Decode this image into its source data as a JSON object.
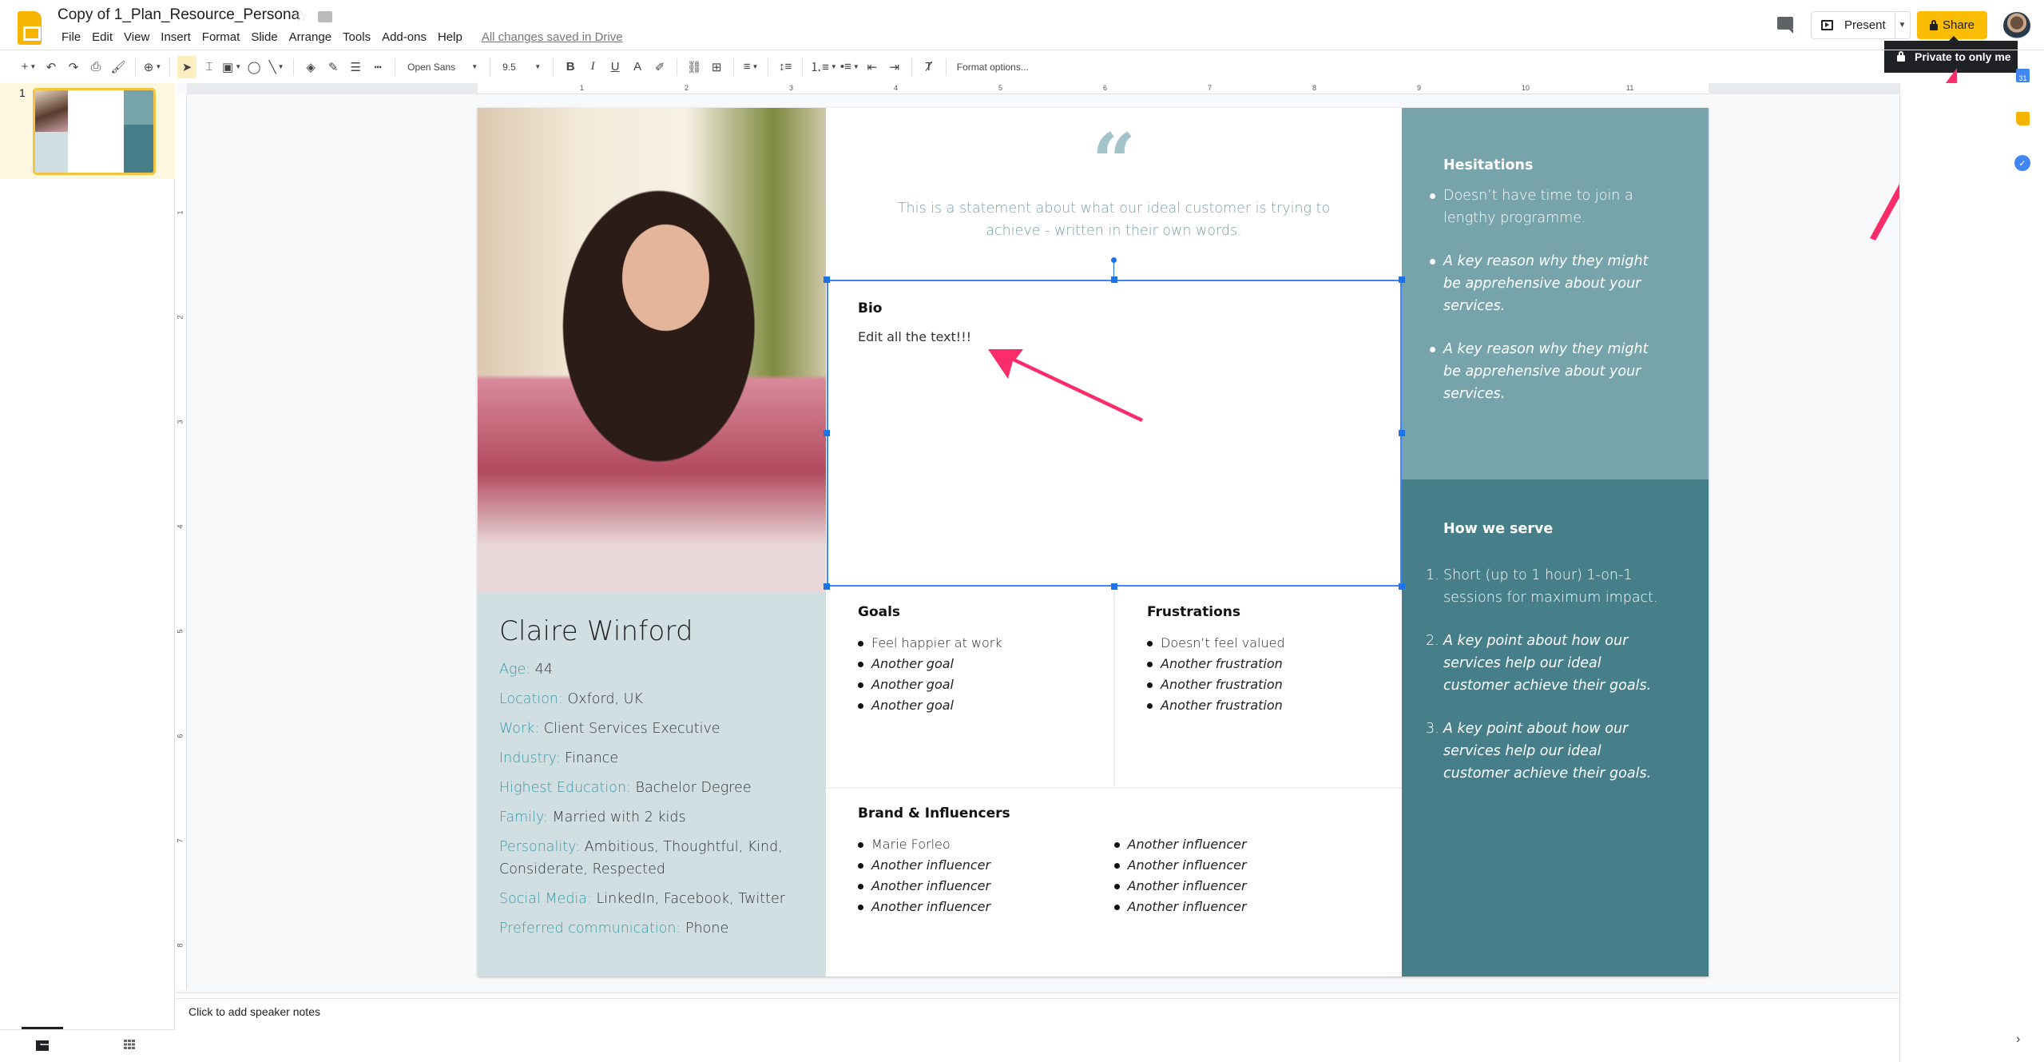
{
  "app": {
    "doc_title": "Copy of 1_Plan_Resource_Persona",
    "save_status": "All changes saved in Drive",
    "menu": [
      "File",
      "Edit",
      "View",
      "Insert",
      "Format",
      "Slide",
      "Arrange",
      "Tools",
      "Add-ons",
      "Help"
    ]
  },
  "header": {
    "present_label": "Present",
    "share_label": "Share",
    "tooltip": "Private to only me"
  },
  "toolbar": {
    "font": "Open Sans",
    "font_size": "9.5",
    "bold": "B",
    "italic": "I",
    "underline": "U",
    "text_color": "A",
    "format_options": "Format options..."
  },
  "ruler": {
    "h_marks": [
      "1",
      "2",
      "3",
      "4",
      "5",
      "6",
      "7",
      "8",
      "9",
      "10",
      "11"
    ],
    "v_marks": [
      "1",
      "2",
      "3",
      "4",
      "5",
      "6",
      "7",
      "8"
    ]
  },
  "filmstrip": {
    "slide_number": "1"
  },
  "slide": {
    "persona": {
      "name": "Claire Winford",
      "attributes": [
        {
          "k": "Age:",
          "v": " 44"
        },
        {
          "k": "Location:",
          "v": " Oxford, UK"
        },
        {
          "k": "Work:",
          "v": " Client Services Executive"
        },
        {
          "k": "Industry:",
          "v": " Finance"
        },
        {
          "k": "Highest Education:",
          "v": " Bachelor Degree"
        },
        {
          "k": "Family:",
          "v": " Married with 2 kids"
        },
        {
          "k": "Personality:",
          "v": " Ambitious, Thoughtful, Kind, Considerate, Respected"
        },
        {
          "k": "Social Media:",
          "v": " LinkedIn, Facebook, Twitter"
        },
        {
          "k": "Preferred communication:",
          "v": " Phone"
        }
      ]
    },
    "quote": {
      "mark": "“",
      "text": "This is a statement about what our ideal customer is trying to achieve - written in their own words."
    },
    "bio": {
      "title": "Bio",
      "text": "Edit all the text!!!"
    },
    "goals": {
      "title": "Goals",
      "items": [
        "Feel happier at work",
        "Another goal",
        "Another goal",
        "Another goal"
      ]
    },
    "frustrations": {
      "title": "Frustrations",
      "items": [
        "Doesn’t feel valued",
        "Another frustration",
        "Another frustration",
        "Another frustration"
      ]
    },
    "brands": {
      "title": "Brand & Influencers",
      "col1": [
        "Marie Forleo",
        "Another influencer",
        "Another influencer",
        "Another influencer"
      ],
      "col2": [
        "Another influencer",
        "Another influencer",
        "Another influencer",
        "Another influencer"
      ]
    },
    "hesitations": {
      "title": "Hesitations",
      "items": [
        "Doesn’t have time to join a lengthy programme.",
        "A key reason why they might be apprehensive about your services.",
        "A key reason why they might be apprehensive about your services."
      ]
    },
    "serve": {
      "title": "How we serve",
      "items": [
        "Short (up to 1 hour) 1-on-1 sessions for maximum impact.",
        "A key point about how our services help our ideal customer achieve their goals.",
        "A key point about how our services help our ideal customer achieve their goals."
      ]
    },
    "colors": {
      "hesitations_bg": "#77a4ab",
      "serve_bg": "#467f8a",
      "profile_bg": "#d1dfe3",
      "attr_key": "#3a9aa5"
    }
  },
  "notes": {
    "placeholder": "Click to add speaker notes"
  },
  "side_panel": {
    "calendar_day": "31"
  },
  "colors": {
    "share": "#fbbc04",
    "annotation_arrow": "#fb2c6a",
    "selection": "#1a73e8"
  }
}
